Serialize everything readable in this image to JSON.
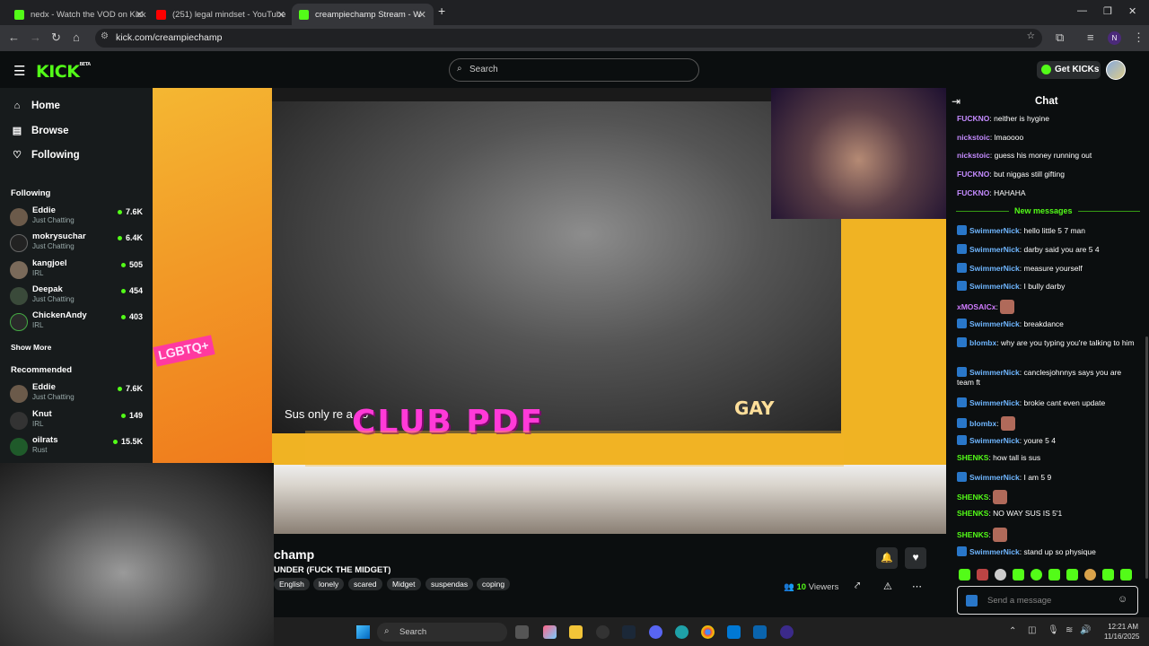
{
  "browser": {
    "tabs": [
      {
        "title": "nedx - Watch the VOD on Kick",
        "color": "#53fc18"
      },
      {
        "title": "(251) legal mindset - YouTube",
        "color": "#ff0000"
      },
      {
        "title": "creampiechamp Stream - W",
        "color": "#53fc18"
      }
    ],
    "url": "kick.com/creampiechamp",
    "profile_initial": "N"
  },
  "header": {
    "logo": "KICK",
    "logo_sup": "BETA",
    "search_placeholder": "Search",
    "get_kicks": "Get KICKs"
  },
  "sidebar": {
    "nav": [
      {
        "label": "Home",
        "icon": "home-icon"
      },
      {
        "label": "Browse",
        "icon": "browse-icon"
      },
      {
        "label": "Following",
        "icon": "heart-icon"
      }
    ],
    "following_title": "Following",
    "following": [
      {
        "name": "Eddie",
        "category": "Just Chatting",
        "viewers": "7.6K"
      },
      {
        "name": "mokrysuchar",
        "category": "Just Chatting",
        "viewers": "6.4K"
      },
      {
        "name": "kangjoel",
        "category": "IRL",
        "viewers": "505"
      },
      {
        "name": "Deepak",
        "category": "Just Chatting",
        "viewers": "454"
      },
      {
        "name": "ChickenAndy",
        "category": "IRL",
        "viewers": "403"
      }
    ],
    "show_more": "Show More",
    "recommended_title": "Recommended",
    "recommended": [
      {
        "name": "Eddie",
        "category": "Just Chatting",
        "viewers": "7.6K"
      },
      {
        "name": "Knut",
        "category": "IRL",
        "viewers": "149"
      },
      {
        "name": "oilrats",
        "category": "Rust",
        "viewers": "15.5K"
      }
    ]
  },
  "video": {
    "overlay_text": "CLUB PDF",
    "subtitle": "Sus only re        a        co",
    "lgbtq": "LGBTQ+",
    "gay": "GAY"
  },
  "stream": {
    "channel": "champ",
    "title": "UNDER (FUCK THE MIDGET)",
    "tags": [
      "English",
      "lonely",
      "scared",
      "Midget",
      "suspendas",
      "coping"
    ],
    "viewers": "10",
    "viewers_label": "Viewers"
  },
  "chat": {
    "title": "Chat",
    "new_messages_label": "New messages",
    "messages_before": [
      {
        "user": "FUCKNO",
        "color": "#c48bff",
        "text": "neither is hygine",
        "badge": false
      },
      {
        "user": "nickstoic",
        "color": "#c48bff",
        "text": "lmaoooo",
        "badge": false
      },
      {
        "user": "nickstoic",
        "color": "#c48bff",
        "text": "guess his money running out",
        "badge": false
      },
      {
        "user": "FUCKNO",
        "color": "#c48bff",
        "text": "but niggas still gifting",
        "badge": false
      },
      {
        "user": "FUCKNO",
        "color": "#c48bff",
        "text": "HAHAHA",
        "badge": false
      }
    ],
    "messages_after": [
      {
        "user": "SwimmerNick",
        "color": "#6fb6ff",
        "text": "hello little 5 7 man",
        "badge": true
      },
      {
        "user": "SwimmerNick",
        "color": "#6fb6ff",
        "text": "darby said you are 5 4",
        "badge": true
      },
      {
        "user": "SwimmerNick",
        "color": "#6fb6ff",
        "text": "measure yourself",
        "badge": true
      },
      {
        "user": "SwimmerNick",
        "color": "#6fb6ff",
        "text": "I bully darby",
        "badge": true
      },
      {
        "user": "xMOSAICx",
        "color": "#d07cff",
        "text": "",
        "badge": false,
        "emote": true
      },
      {
        "user": "SwimmerNick",
        "color": "#6fb6ff",
        "text": "breakdance",
        "badge": true
      },
      {
        "user": "blombx",
        "color": "#6fb6ff",
        "text": "why are you typing you're talking to him",
        "badge": true
      },
      {
        "user": "SwimmerNick",
        "color": "#6fb6ff",
        "text": "canclesjohnnys says you are team ft",
        "badge": true
      },
      {
        "user": "SwimmerNick",
        "color": "#6fb6ff",
        "text": "brokie cant even update",
        "badge": true
      },
      {
        "user": "blombx",
        "color": "#6fb6ff",
        "text": "",
        "badge": true,
        "emote": true
      },
      {
        "user": "SwimmerNick",
        "color": "#6fb6ff",
        "text": "youre 5 4",
        "badge": true
      },
      {
        "user": "SHENKS",
        "color": "#53fc18",
        "text": "how tall is sus",
        "badge": false
      },
      {
        "user": "SwimmerNick",
        "color": "#6fb6ff",
        "text": "I am 5 9",
        "badge": true
      },
      {
        "user": "SHENKS",
        "color": "#53fc18",
        "text": "",
        "badge": false,
        "emote": true
      },
      {
        "user": "SHENKS",
        "color": "#53fc18",
        "text": "NO WAY SUS IS 5'1",
        "badge": false
      },
      {
        "user": "SHENKS",
        "color": "#53fc18",
        "text": "",
        "badge": false,
        "emote": true
      },
      {
        "user": "SwimmerNick",
        "color": "#6fb6ff",
        "text": "stand up so physique",
        "badge": true
      }
    ],
    "input_placeholder": "Send a message"
  },
  "taskbar": {
    "search": "Search",
    "time": "12:21 AM",
    "date": "11/16/2025"
  },
  "colors": {
    "accent": "#53fc18",
    "background": "#0b0e0f",
    "sidebar": "#171b1c"
  }
}
